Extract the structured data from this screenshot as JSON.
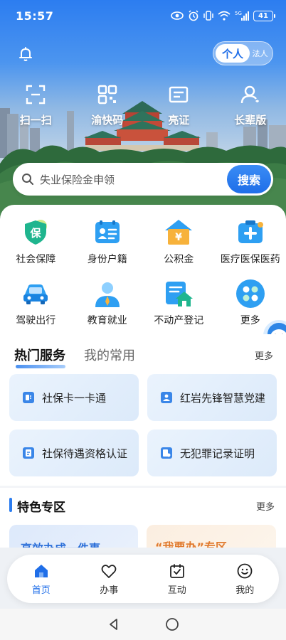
{
  "status": {
    "time": "15:57",
    "battery": "41"
  },
  "toggle": {
    "personal": "个人",
    "legal": "法人"
  },
  "quick": [
    {
      "label": "扫一扫",
      "icon": "scan-icon"
    },
    {
      "label": "渝快码",
      "icon": "qr-code-icon"
    },
    {
      "label": "亮证",
      "icon": "id-card-icon"
    },
    {
      "label": "长辈版",
      "icon": "elder-icon"
    }
  ],
  "search": {
    "placeholder": "失业保险金申领",
    "button": "搜索"
  },
  "services": [
    {
      "label": "社会保障",
      "icon": "shield-icon"
    },
    {
      "label": "身份户籍",
      "icon": "id-badge-icon"
    },
    {
      "label": "公积金",
      "icon": "housing-fund-icon"
    },
    {
      "label": "医疗医保医药",
      "icon": "medical-kit-icon"
    },
    {
      "label": "驾驶出行",
      "icon": "car-icon"
    },
    {
      "label": "教育就业",
      "icon": "graduate-icon"
    },
    {
      "label": "不动产登记",
      "icon": "property-icon"
    },
    {
      "label": "更多",
      "icon": "more-icon"
    }
  ],
  "hot": {
    "tab_active": "热门服务",
    "tab_inactive": "我的常用",
    "more": "更多",
    "items": [
      {
        "label": "社保卡一卡通"
      },
      {
        "label": "红岩先锋智慧党建"
      },
      {
        "label": "社保待遇资格认证"
      },
      {
        "label": "无犯罪记录证明"
      }
    ]
  },
  "featured": {
    "title": "特色专区",
    "more": "更多",
    "card1": "高效办成一件事",
    "card2": "“我要办”专区"
  },
  "nav": [
    {
      "label": "首页",
      "icon": "home-icon"
    },
    {
      "label": "办事",
      "icon": "heart-icon"
    },
    {
      "label": "互动",
      "icon": "calendar-check-icon"
    },
    {
      "label": "我的",
      "icon": "smile-icon"
    }
  ],
  "colors": {
    "primary": "#1f6ee8",
    "hero_top": "#2c7df0",
    "card_bg": "#e6f0fc"
  }
}
